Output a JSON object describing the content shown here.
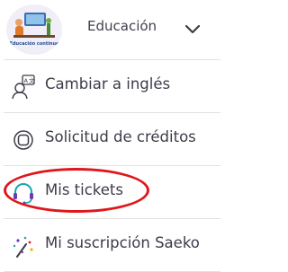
{
  "header": {
    "logo_text": "Educación continua",
    "title": "Educación",
    "chevron_icon": "chevron-down-icon"
  },
  "menu": {
    "items": [
      {
        "label": "Cambiar a inglés",
        "icon": "language-speaker-icon"
      },
      {
        "label": "Solicitud de créditos",
        "icon": "credits-coin-icon"
      },
      {
        "label": "Mis tickets",
        "icon": "headset-support-icon",
        "highlighted": true
      },
      {
        "label": "Mi suscripción Saeko",
        "icon": "sparkle-subscription-icon"
      }
    ]
  },
  "colors": {
    "text": "#3c3c4a",
    "divider": "#e1e1e1",
    "highlight_ring": "#e0161b",
    "support_icon_teal": "#1aa6b0",
    "support_icon_purple": "#6a3bb5"
  }
}
